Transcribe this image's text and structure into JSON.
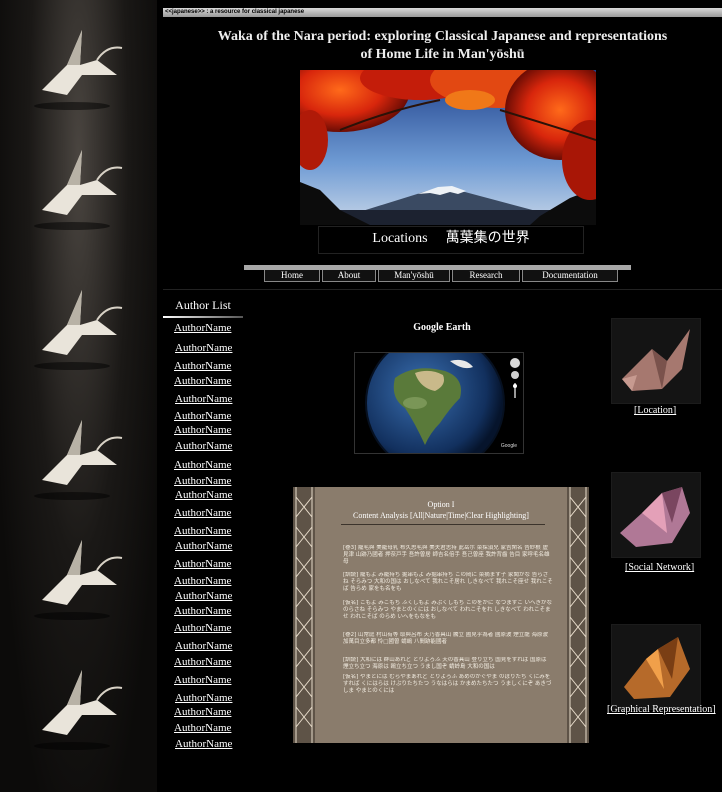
{
  "site_tag": "<<japanese>> : a resource for classical japanese",
  "title_line1": "Waka of the Nara period: exploring Classical Japanese and representations",
  "title_line2": "of Home Life in Man'yōshū",
  "caption_left": "Locations",
  "caption_right": "萬葉集の世界",
  "nav": [
    "Home",
    "About",
    "Man'yōshū",
    "Research",
    "Documentation"
  ],
  "author_list_title": "Author List",
  "authors": [
    "AuthorName",
    "AuthorName",
    "AuthorName",
    "AuthorName",
    "AuthorName",
    "AuthorName",
    "AuthorName",
    "AuthorName",
    "AuthorName",
    "AuthorName",
    "AuthorName",
    "AuthorName",
    "AuthorName",
    "AuthorName",
    "AuthorName",
    "AuthorName",
    "AuthorName",
    "AuthorName",
    "AuthorName",
    "AuthorName",
    "AuthorName",
    "AuthorName",
    "AuthorName",
    "AuthorName",
    "AuthorName",
    "AuthorName"
  ],
  "google_earth_title": "Google Earth",
  "google_logo": "Google",
  "option_title": "Option I",
  "content_analysis_label": "Content Analysis",
  "filters": [
    "All",
    "Nature",
    "Time",
    "Clear Highlighting"
  ],
  "poem_lines": [
    "[巻3] 籠毛與 美籠母乳 布久思毛與 美夫君志持 此岳尓 菜採須兒 家吉閑名 告紗根 虚見津 山跡乃國者 押奈戸手 吾許曽居 師吉名倍手 吾己曽座 我許背齒 告目 家呼毛名雄母",
    "[訓読] 籠もよ み籠持ち 掘串もよ み掘串持ち この岡に 菜摘ます子 家聞かな 告らさね そらみつ 大和の国は おしなべて 我れこそ居れ しきなべて 我れこそ座せ 我れこそば 告らめ 家をも名をも",
    "[仮名] こもよ みこもち ふくしもよ みぶくしもち このをかに なつますこ いへきかな のらさね そらみつ やまとのくには おしなべて われこそをれ しきなべて われこそませ われこそば のらめ いへをもなをも",
    "[巻2] 山常庭 村山有等 取與呂布 天乃香具山 騰立 國見乎為者 國原波 煙立龍 海原波 加萬目立多都 怜□國曽 蜻嶋 八間跡能國者",
    "[訓読] 大和には 群山あれど とりよろふ 天の香具山 登り立ち 国見をすれば 国原は 煙立ち立つ 海原は 鴎立ち立つ うまし国ぞ 蜻蛉島 大和の国は",
    "[仮名] やまとには むらやまあれど とりよろふ あめのかぐやま のぼりたち くにみをすれば くにはらは けぶりたちたつ うなはらは かまめたちたつ うましくにぞ あきづしま やまとのくには"
  ],
  "thumb_labels": [
    "[Location]",
    "[Social Network]",
    "[Graphical Representation]"
  ]
}
